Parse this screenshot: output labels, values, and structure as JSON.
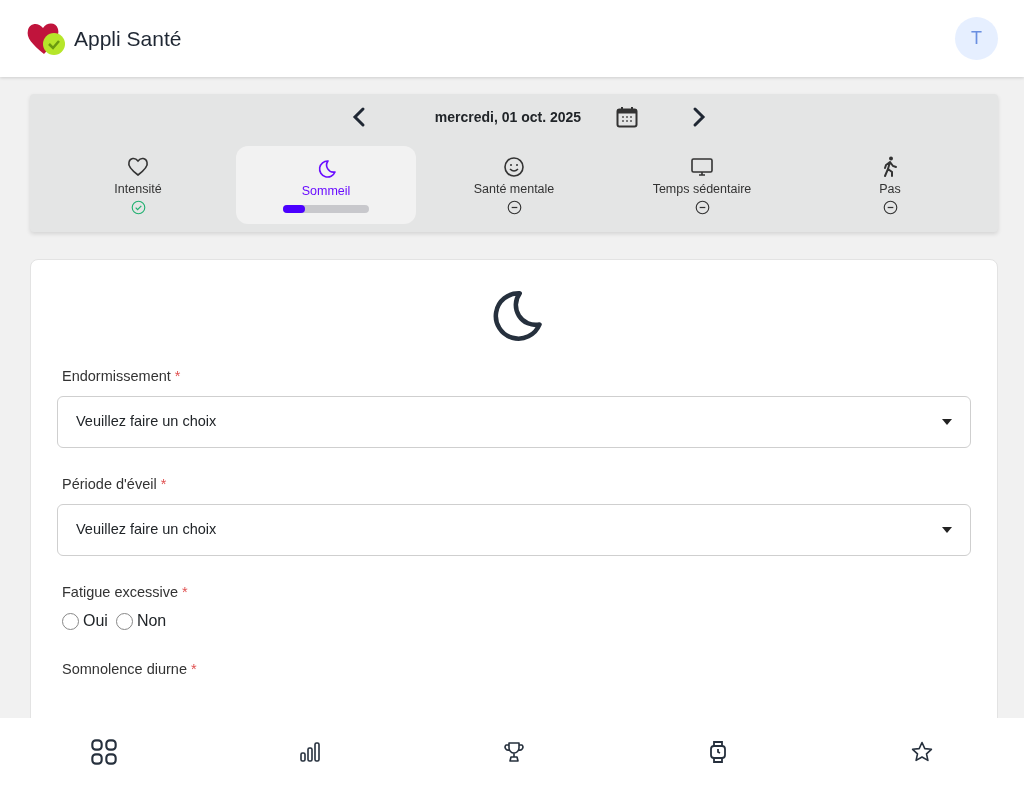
{
  "app": {
    "title": "Appli Santé",
    "avatar": "T"
  },
  "date_nav": {
    "date": "mercredi, 01 oct. 2025"
  },
  "tabs": [
    {
      "label": "Intensité",
      "selected": false,
      "kind": "done"
    },
    {
      "label": "Sommeil",
      "selected": true,
      "kind": "progress",
      "level": 0.25
    },
    {
      "label": "Santé mentale",
      "selected": false,
      "kind": "pending"
    },
    {
      "label": "Temps sédentaire",
      "selected": false,
      "kind": "pending"
    },
    {
      "label": "Pas",
      "selected": false,
      "kind": "pending"
    }
  ],
  "form": {
    "questions": [
      {
        "kind": "select",
        "label": "Endormissement",
        "required_mark": "*",
        "placeholder": "Veuillez faire un choix"
      },
      {
        "kind": "select",
        "label": "Période d'éveil",
        "required_mark": "*",
        "placeholder": "Veuillez faire un choix"
      },
      {
        "kind": "radio",
        "label": "Fatigue excessive",
        "required_mark": "*",
        "options": [
          {
            "label": "Oui",
            "selected": false
          },
          {
            "label": "Non",
            "selected": false
          }
        ]
      },
      {
        "kind": "radio",
        "label": "Somnolence diurne",
        "required_mark": "*"
      }
    ]
  },
  "bottom_nav": [
    {
      "selected": false
    },
    {
      "selected": false
    },
    {
      "selected": false
    },
    {
      "selected": false
    },
    {
      "selected": false
    }
  ]
}
